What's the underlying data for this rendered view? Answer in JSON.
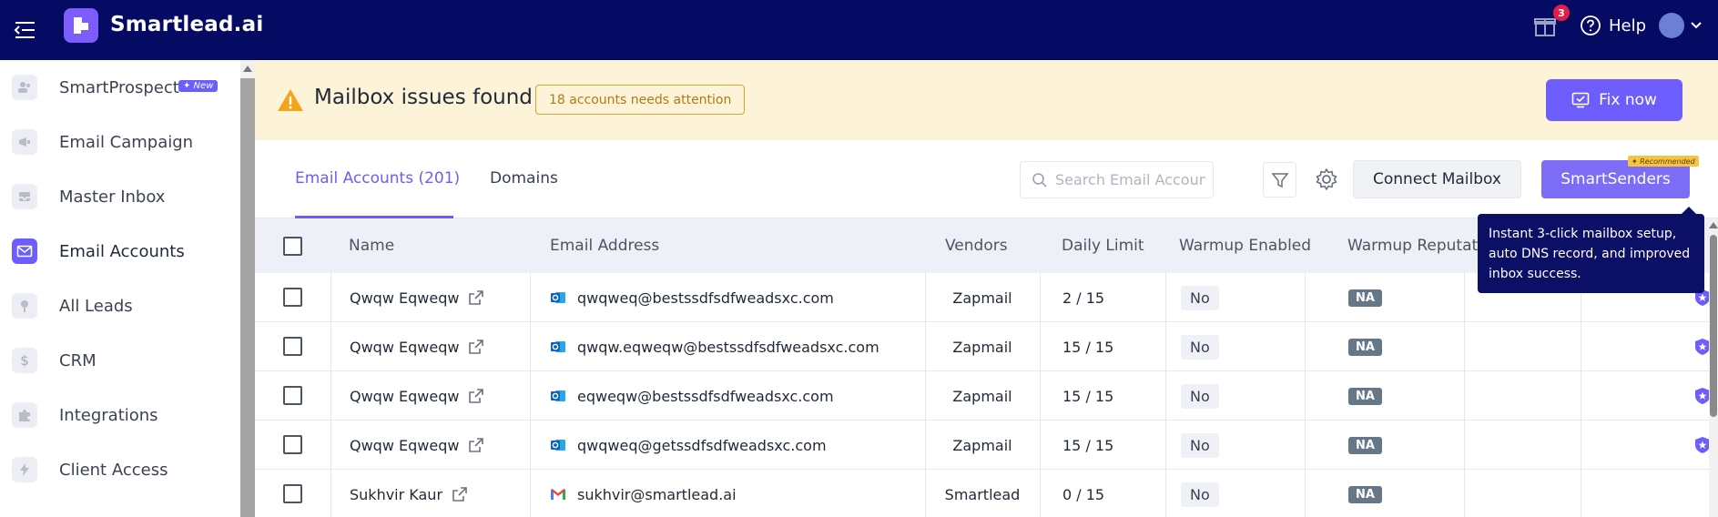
{
  "header": {
    "brand": "Smartlead.ai",
    "notification_count": "3",
    "help_label": "Help"
  },
  "sidebar": {
    "items": [
      {
        "label": "SmartProspect",
        "icon": "users-icon",
        "tag": "✦ New"
      },
      {
        "label": "Email Campaign",
        "icon": "megaphone-icon"
      },
      {
        "label": "Master Inbox",
        "icon": "inbox-icon"
      },
      {
        "label": "Email Accounts",
        "icon": "mail-icon",
        "active": true
      },
      {
        "label": "All Leads",
        "icon": "leads-icon"
      },
      {
        "label": "CRM",
        "icon": "dollar-icon"
      },
      {
        "label": "Integrations",
        "icon": "puzzle-icon"
      },
      {
        "label": "Client Access",
        "icon": "lightning-icon"
      }
    ]
  },
  "alert": {
    "title": "Mailbox issues found",
    "chip": "18 accounts needs attention",
    "fix_label": "Fix now"
  },
  "tabs": {
    "email_accounts": "Email Accounts (201)",
    "domains": "Domains"
  },
  "toolbar": {
    "search_placeholder": "Search Email Account",
    "connect_label": "Connect Mailbox",
    "smartsenders_label": "SmartSenders",
    "recommended_tag": "✦ Recommended"
  },
  "tooltip": {
    "text": "Instant 3-click mailbox setup, auto DNS record, and improved inbox success."
  },
  "table": {
    "columns": [
      "Name",
      "Email Address",
      "Vendors",
      "Daily Limit",
      "Warmup Enabled",
      "Warmup Reputat"
    ],
    "rows": [
      {
        "name": "Qwqw Eqweqw",
        "email": "qwqweq@bestssdfsdfweadsxc.com",
        "provider": "outlook",
        "vendor": "Zapmail",
        "limit": "2 / 15",
        "warmup": "No",
        "reputation": "NA"
      },
      {
        "name": "Qwqw Eqweqw",
        "email": "qwqw.eqweqw@bestssdfsdfweadsxc.com",
        "provider": "outlook",
        "vendor": "Zapmail",
        "limit": "15 / 15",
        "warmup": "No",
        "reputation": "NA"
      },
      {
        "name": "Qwqw Eqweqw",
        "email": "eqweqw@bestssdfsdfweadsxc.com",
        "provider": "outlook",
        "vendor": "Zapmail",
        "limit": "15 / 15",
        "warmup": "No",
        "reputation": "NA"
      },
      {
        "name": "Qwqw Eqweqw",
        "email": "qwqweq@getssdfsdfweadsxc.com",
        "provider": "outlook",
        "vendor": "Zapmail",
        "limit": "15 / 15",
        "warmup": "No",
        "reputation": "NA"
      },
      {
        "name": "Sukhvir Kaur",
        "email": "sukhvir@smartlead.ai",
        "provider": "gmail",
        "vendor": "Smartlead",
        "limit": "0 / 15",
        "warmup": "No",
        "reputation": "NA"
      }
    ]
  },
  "colors": {
    "topbar": "#050a63",
    "accent": "#6d5dfc",
    "alert_bg": "#fdf3d8",
    "tooltip_bg": "#0b0f66"
  }
}
